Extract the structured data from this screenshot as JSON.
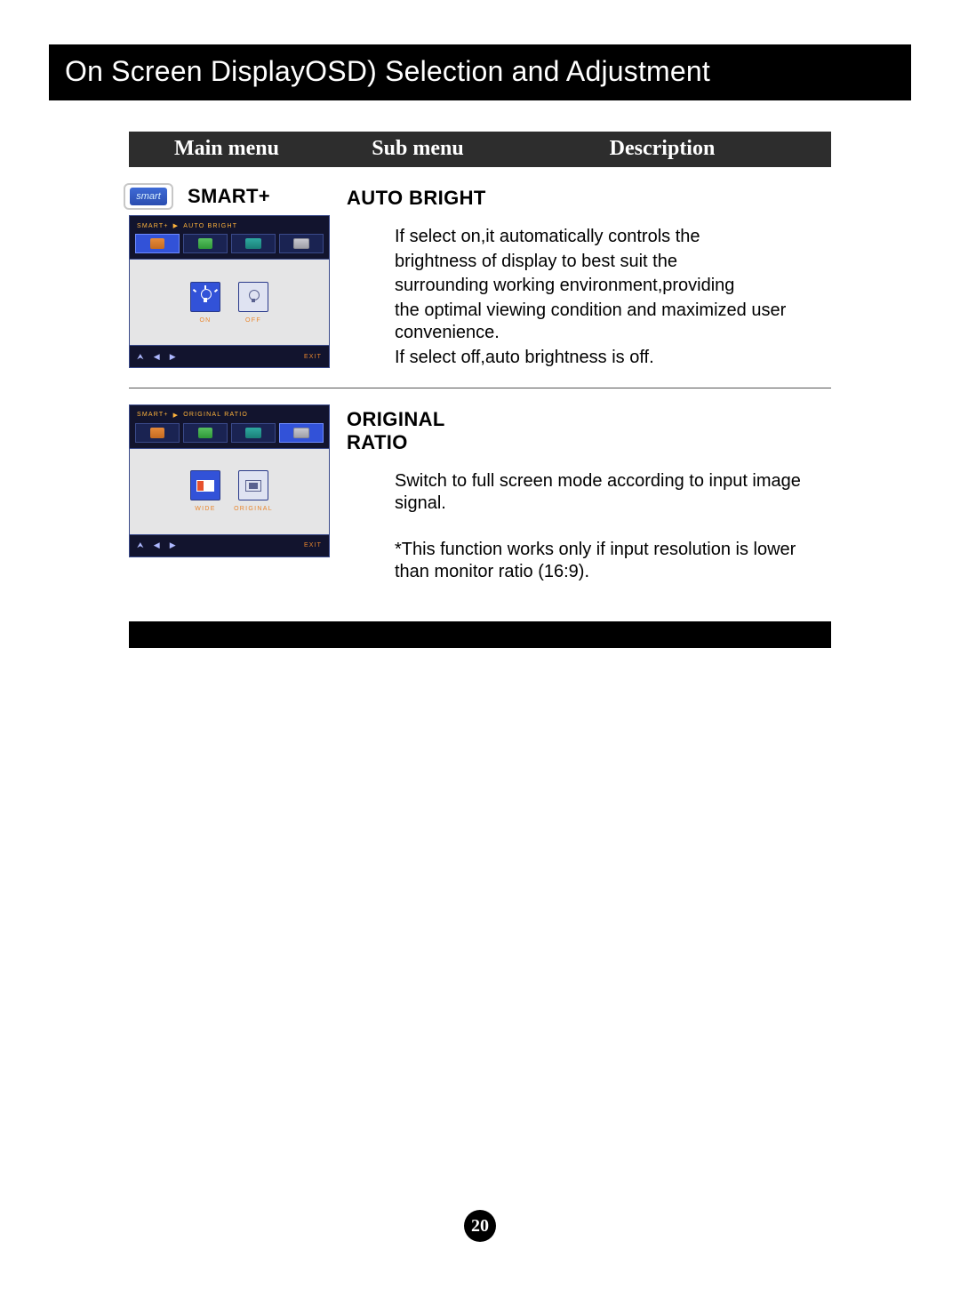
{
  "page_title": "On Screen DisplayOSD) Selection and Adjustment",
  "columns": {
    "main": "Main menu",
    "sub": "Sub menu",
    "desc": "Description"
  },
  "badge_text": "smart",
  "smart_label": "SMART+",
  "osd1": {
    "crumb_a": "SMART+",
    "crumb_b": "AUTO BRIGHT",
    "opt_on": "ON",
    "opt_off": "OFF",
    "exit": "EXIT"
  },
  "osd2": {
    "crumb_a": "SMART+",
    "crumb_b": "ORIGINAL RATIO",
    "opt_wide": "WIDE",
    "opt_orig": "ORIGINAL",
    "exit": "EXIT"
  },
  "section1": {
    "title": "AUTO BRIGHT",
    "p1": "If select on,it automatically controls the",
    "p2": "brightness of display to best suit the",
    "p3": "surrounding working environment,providing",
    "p4": "the optimal viewing condition and maximized user convenience.",
    "p5": "If select off,auto brightness is off."
  },
  "section2": {
    "title_l1": "ORIGINAL",
    "title_l2": "RATIO",
    "p1": "Switch to full screen mode according to input image signal.",
    "p2": "*This function works only if input resolution is lower than monitor ratio (16:9)."
  },
  "page_number": "20"
}
